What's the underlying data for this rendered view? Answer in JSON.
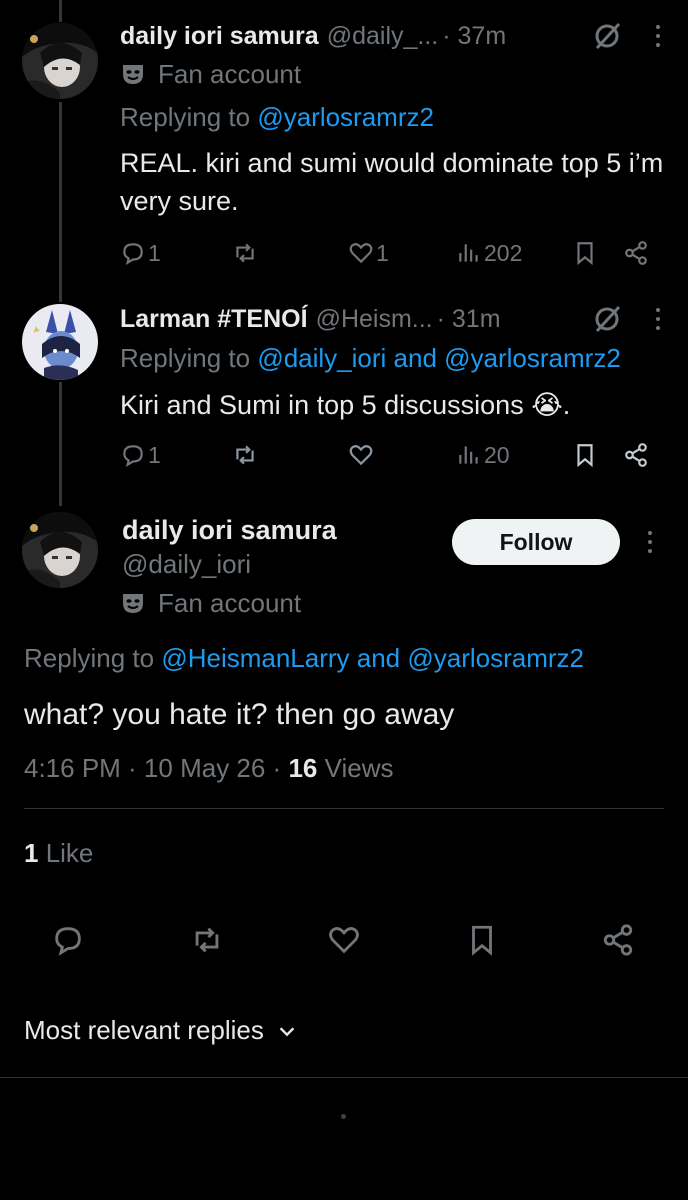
{
  "colors": {
    "background": "#000000",
    "text": "#e7e9ea",
    "muted": "#71767b",
    "accent": "#1d9bf0",
    "follow_bg": "#eff3f4"
  },
  "thread": [
    {
      "display_name": "daily iori samura",
      "handle": "@daily_...",
      "time": "· 37m",
      "badge": "Fan account",
      "replying_prefix": "Replying to ",
      "mentions": "@yarlosramrz2",
      "text": "REAL. kiri and sumi would dominate top 5 i’m very sure.",
      "replies": "1",
      "reposts": "",
      "likes": "1",
      "views": "202"
    },
    {
      "display_name": "Larman #TENOÍ",
      "handle": "@Heism...",
      "time": "· 31m",
      "replying_prefix": "Replying to ",
      "mentions": "@daily_iori and @yarlosramrz2",
      "text": "Kiri and Sumi in top 5 discussions 😭.",
      "replies": "1",
      "reposts": "",
      "likes": "",
      "views": "20"
    }
  ],
  "main_tweet": {
    "display_name": "daily iori samura",
    "handle": "@daily_iori",
    "badge": "Fan account",
    "follow_label": "Follow",
    "replying_prefix": "Replying to ",
    "mentions": "@HeismanLarry and @yarlosramrz2",
    "text": "what? you hate it? then go away",
    "time": "4:16 PM · 10 May 26 · ",
    "views_count": "16",
    "views_label": " Views",
    "likes_count": "1",
    "likes_label": " Like"
  },
  "replies_sort": {
    "label": "Most relevant replies",
    "icon": "chevron-down-icon"
  },
  "icons": [
    "reply-icon",
    "repost-icon",
    "like-icon",
    "views-icon",
    "bookmark-icon",
    "share-icon",
    "grok-icon",
    "more-icon",
    "fan-mask-icon"
  ]
}
